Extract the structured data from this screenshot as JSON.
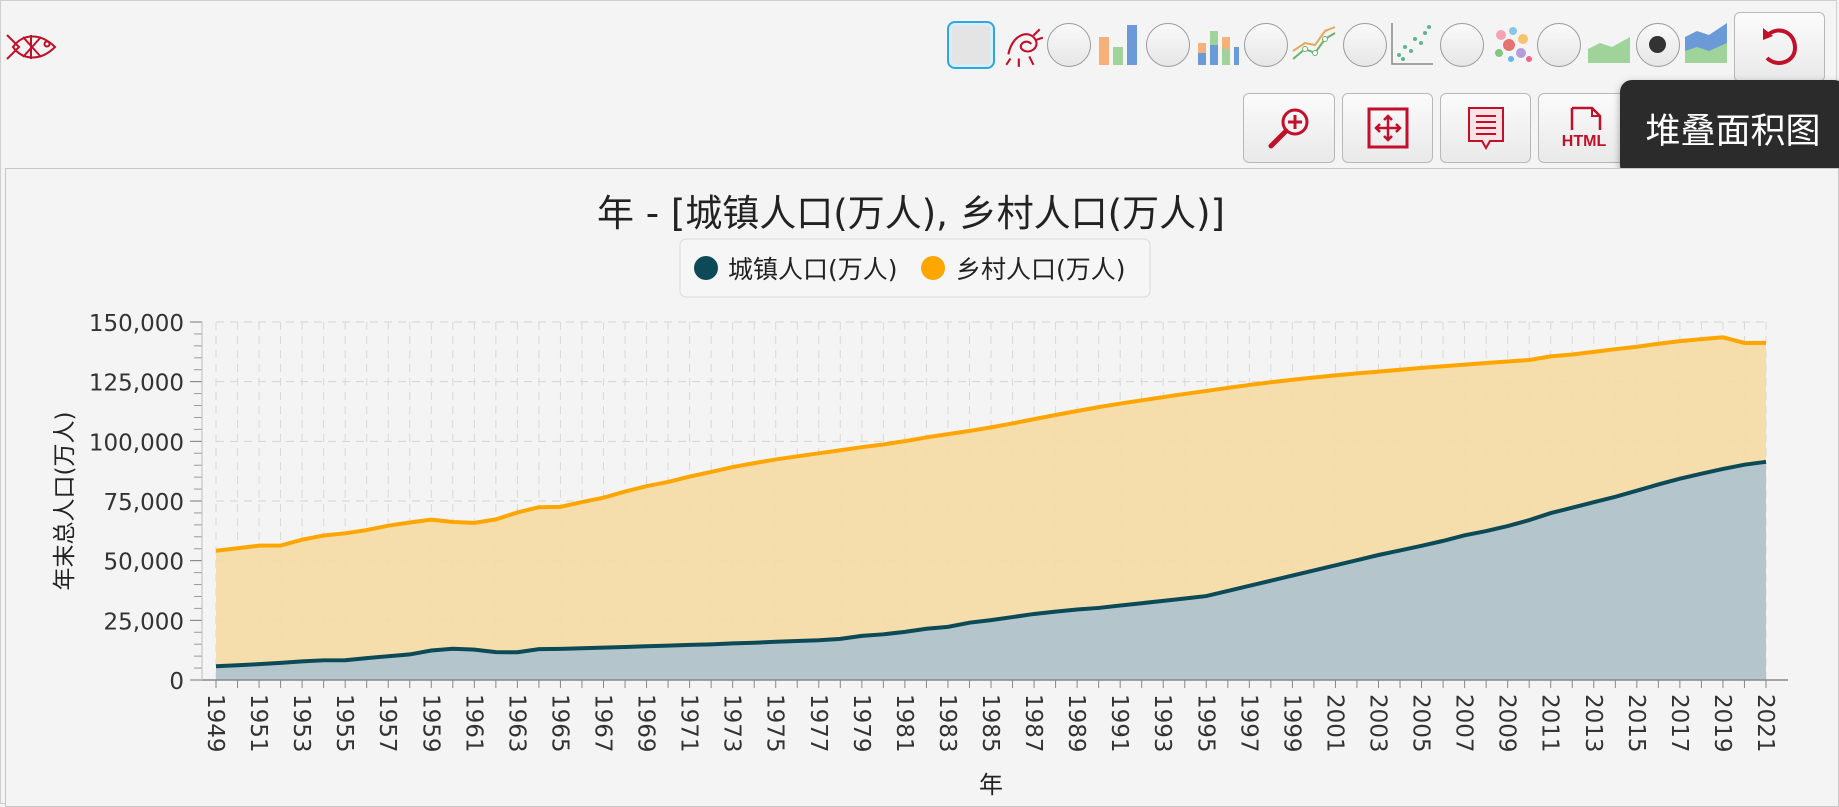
{
  "app": {
    "tooltip": "堆叠面积图"
  },
  "chart_types": [
    {
      "name": "bar",
      "selected": false
    },
    {
      "name": "line",
      "selected": false
    },
    {
      "name": "scatter",
      "selected": false
    },
    {
      "name": "bubble",
      "selected": false
    },
    {
      "name": "area",
      "selected": false
    },
    {
      "name": "stacked-area",
      "selected": true
    }
  ],
  "toolbar": [
    {
      "name": "zoom-in",
      "icon": "zoom-in-icon"
    },
    {
      "name": "fit",
      "icon": "fit-screen-icon"
    },
    {
      "name": "data-view",
      "icon": "list-note-icon"
    },
    {
      "name": "html",
      "icon": "html-file-icon",
      "text": "HTML"
    }
  ],
  "colors": {
    "urban": "#0d4a57",
    "rural": "#ffa500",
    "urban_fill": "#b4c6cc",
    "rural_fill": "#f6dca8",
    "accent": "#c0102a"
  },
  "chart_data": {
    "type": "area",
    "stacked": true,
    "title": "年 - [城镇人口(万人), 乡村人口(万人)]",
    "xlabel": "年",
    "ylabel": "年末总人口(万人)",
    "ylim": [
      0,
      150000
    ],
    "yticks": [
      "0",
      "25,000",
      "50,000",
      "75,000",
      "100,000",
      "125,000",
      "150,000"
    ],
    "legend_position": "top-center",
    "grid": true,
    "x": [
      1949,
      1950,
      1951,
      1952,
      1953,
      1954,
      1955,
      1956,
      1957,
      1958,
      1959,
      1960,
      1961,
      1962,
      1963,
      1964,
      1965,
      1966,
      1967,
      1968,
      1969,
      1970,
      1971,
      1972,
      1973,
      1974,
      1975,
      1976,
      1977,
      1978,
      1979,
      1980,
      1981,
      1982,
      1983,
      1984,
      1985,
      1986,
      1987,
      1988,
      1989,
      1990,
      1991,
      1992,
      1993,
      1994,
      1995,
      1996,
      1997,
      1998,
      1999,
      2000,
      2001,
      2002,
      2003,
      2004,
      2005,
      2006,
      2007,
      2008,
      2009,
      2010,
      2011,
      2012,
      2013,
      2014,
      2015,
      2016,
      2017,
      2018,
      2019,
      2020,
      2021
    ],
    "xticks": [
      1949,
      1951,
      1953,
      1955,
      1957,
      1959,
      1961,
      1963,
      1965,
      1967,
      1969,
      1971,
      1973,
      1975,
      1977,
      1979,
      1981,
      1983,
      1985,
      1987,
      1989,
      1991,
      1993,
      1995,
      1997,
      1999,
      2001,
      2003,
      2005,
      2007,
      2009,
      2011,
      2013,
      2015,
      2017,
      2019,
      2021
    ],
    "series": [
      {
        "name": "城镇人口(万人)",
        "values": [
          5765,
          6169,
          6632,
          7163,
          7826,
          8249,
          8285,
          9185,
          9949,
          10721,
          12371,
          13073,
          12707,
          11659,
          11646,
          12950,
          13045,
          13313,
          13548,
          13838,
          14117,
          14424,
          14711,
          14935,
          15345,
          15595,
          16030,
          16341,
          16669,
          17245,
          18495,
          19140,
          20171,
          21480,
          22274,
          24017,
          25094,
          26366,
          27674,
          28661,
          29540,
          30195,
          31203,
          32175,
          33173,
          34169,
          35174,
          37304,
          39449,
          41608,
          43748,
          45906,
          48064,
          50212,
          52376,
          54283,
          56212,
          58288,
          60633,
          62403,
          64512,
          66978,
          69927,
          72175,
          74502,
          76738,
          79302,
          81924,
          84343,
          86433,
          88426,
          90220,
          91425
        ]
      },
      {
        "name": "乡村人口(万人)",
        "values": [
          48402,
          49027,
          49674,
          49191,
          50970,
          52293,
          53180,
          53643,
          54704,
          55273,
          54836,
          53134,
          53152,
          55636,
          58561,
          59447,
          59493,
          61229,
          62820,
          65096,
          67074,
          68568,
          70518,
          72242,
          73866,
          75264,
          76390,
          77376,
          78305,
          79014,
          79047,
          79565,
          79901,
          80174,
          80734,
          80340,
          80757,
          81141,
          81626,
          82365,
          83164,
          84138,
          84620,
          84996,
          85344,
          85681,
          85947,
          85085,
          84177,
          83153,
          82038,
          80837,
          79563,
          78241,
          76851,
          75705,
          74544,
          73160,
          71496,
          70399,
          68938,
          67113,
          65656,
          64222,
          62961,
          61866,
          60346,
          58973,
          57661,
          56401,
          55162,
          50992,
          49835
        ]
      }
    ]
  }
}
